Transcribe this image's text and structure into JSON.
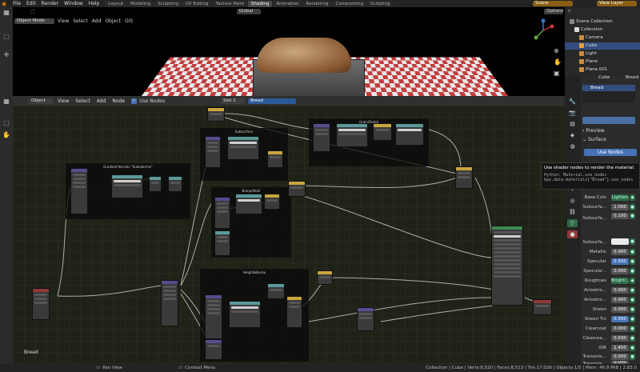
{
  "topbar": {
    "menus": [
      "File",
      "Edit",
      "Render",
      "Window",
      "Help"
    ],
    "workspace_tabs": [
      "Layout",
      "Modeling",
      "Sculpting",
      "UV Editing",
      "Texture Paint",
      "Shading",
      "Animation",
      "Rendering",
      "Compositing",
      "Scripting"
    ],
    "active_tab": "Shading",
    "scene_label": "Scene",
    "view_layer_label": "View Layer"
  },
  "viewport_header": {
    "mode": "Object Mode",
    "menus": [
      "View",
      "Select",
      "Add",
      "Object",
      "GIS"
    ],
    "transform": "Global",
    "options": "Options"
  },
  "node_header": {
    "editor_type": "Object",
    "menus": [
      "View",
      "Select",
      "Add",
      "Node"
    ],
    "use_nodes_label": "Use Nodes",
    "slot": "Slot 1",
    "material": "Bread"
  },
  "frames": [
    "Gradient Kernels \"Subsdermis\"",
    "Subsurface",
    "Bumpdetail",
    "Grain/Detail",
    "Height&Bump"
  ],
  "node_editor": {
    "object_label": "Bread"
  },
  "outliner": {
    "items": [
      {
        "label": "Scene Collection",
        "icon": "scene-collection-icon",
        "color": "#888888",
        "indent": 0,
        "selected": false
      },
      {
        "label": "Collection",
        "icon": "collection-icon",
        "color": "#dddddd",
        "indent": 1,
        "selected": false
      },
      {
        "label": "Camera",
        "icon": "camera-icon",
        "color": "#d08a3c",
        "indent": 2,
        "selected": false
      },
      {
        "label": "Cube",
        "icon": "mesh-icon",
        "color": "#e8a23c",
        "indent": 2,
        "selected": true
      },
      {
        "label": "Light",
        "icon": "light-icon",
        "color": "#d08a3c",
        "indent": 2,
        "selected": false
      },
      {
        "label": "Plane",
        "icon": "mesh-icon",
        "color": "#d08a3c",
        "indent": 2,
        "selected": false
      },
      {
        "label": "Plane.001",
        "icon": "mesh-icon",
        "color": "#d08a3c",
        "indent": 2,
        "selected": false
      }
    ]
  },
  "properties": {
    "object": "Cube",
    "material_name": "Bread",
    "material_slot": "Bread",
    "panels": [
      "Preview",
      "Surface"
    ],
    "use_nodes_button": "Use Nodes",
    "base_color_label": "Base Colo",
    "base_color_value": "Lighten",
    "fields": [
      {
        "label": "Subsurfa...",
        "value": "1.000",
        "style": "gray"
      },
      {
        "label": "Subsurfa...",
        "value": "0.100",
        "style": "gray"
      },
      {
        "label": "Subsurfa...",
        "value": "",
        "style": "white"
      },
      {
        "label": "Metallic",
        "value": "0.000",
        "style": "gray"
      },
      {
        "label": "Specular",
        "value": "0.500",
        "style": "blue"
      },
      {
        "label": "Specular...",
        "value": "0.000",
        "style": "gray"
      },
      {
        "label": "Roughnes",
        "value": "Bright/...",
        "style": "node"
      },
      {
        "label": "Anisotro...",
        "value": "0.000",
        "style": "gray"
      },
      {
        "label": "Anisotro...",
        "value": "0.000",
        "style": "gray"
      },
      {
        "label": "Sheen",
        "value": "0.000",
        "style": "gray"
      },
      {
        "label": "Sheen Tin",
        "value": "0.500",
        "style": "blue"
      },
      {
        "label": "Clearcoat",
        "value": "0.000",
        "style": "gray"
      },
      {
        "label": "Clearcoa...",
        "value": "0.030",
        "style": "gray"
      },
      {
        "label": "IOR",
        "value": "1.450",
        "style": "gray"
      },
      {
        "label": "Transmis...",
        "value": "0.000",
        "style": "gray"
      },
      {
        "label": "Transmis...",
        "value": "0.000",
        "style": "gray"
      }
    ]
  },
  "tooltip": {
    "title": "Use shader nodes to render the material.",
    "python": "Python: Material.use_nodes",
    "path": "bpy.data.materials[\"Bread\"].use_nodes"
  },
  "status": {
    "pan": "Pan View",
    "context": "Context Menu",
    "stats": "Collection | Cube | Verts:8,520 | Faces:8,513 | Tris:17,026 | Objects:1/5 | Mem: 46.8 MiB | 2.83.0"
  }
}
